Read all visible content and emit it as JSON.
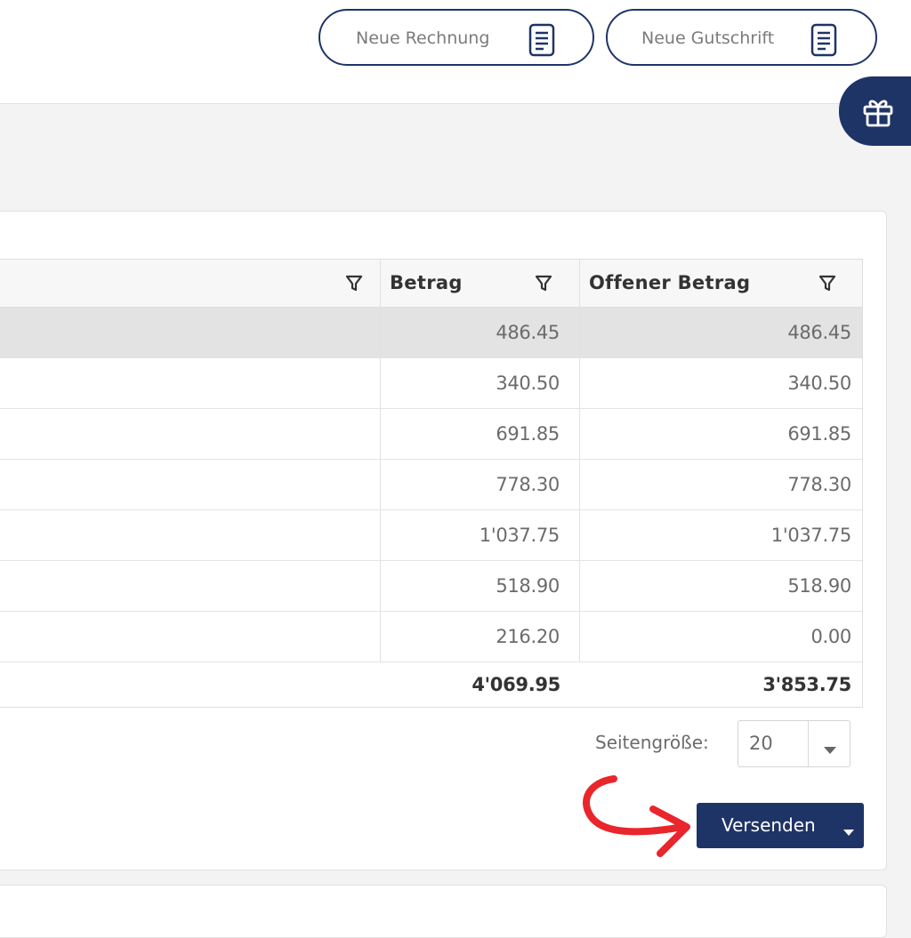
{
  "toolbar": {
    "new_invoice_label": "Neue Rechnung",
    "new_credit_label": "Neue Gutschrift"
  },
  "grid": {
    "columns": [
      {
        "label": ""
      },
      {
        "label": "Betrag"
      },
      {
        "label": "Offener Betrag"
      }
    ],
    "rows": [
      {
        "betrag": "486.45",
        "offen": "486.45",
        "selected": true
      },
      {
        "betrag": "340.50",
        "offen": "340.50",
        "selected": false
      },
      {
        "betrag": "691.85",
        "offen": "691.85",
        "selected": false
      },
      {
        "betrag": "778.30",
        "offen": "778.30",
        "selected": false
      },
      {
        "betrag": "1'037.75",
        "offen": "1'037.75",
        "selected": false
      },
      {
        "betrag": "518.90",
        "offen": "518.90",
        "selected": false
      },
      {
        "betrag": "216.20",
        "offen": "0.00",
        "selected": false
      }
    ],
    "totals": {
      "betrag": "4'069.95",
      "offen": "3'853.75"
    }
  },
  "pager": {
    "label": "Seitengröße:",
    "page_size": "20"
  },
  "actions": {
    "send_label": "Versenden"
  },
  "colors": {
    "primary": "#1f3466",
    "annotation_arrow": "#e8262b",
    "selected_row": "#e3e3e3"
  },
  "icons": [
    "document-icon",
    "gift-icon",
    "filter-icon",
    "chevron-down-icon",
    "curved-arrow-annotation"
  ]
}
